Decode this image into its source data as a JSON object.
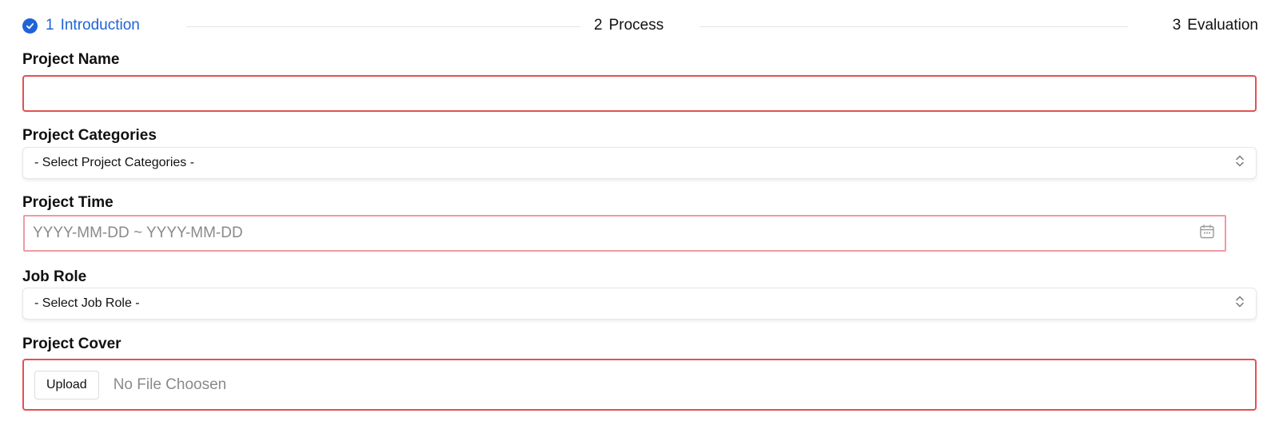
{
  "stepper": {
    "steps": [
      {
        "number": "1",
        "label": "Introduction",
        "state": "active"
      },
      {
        "number": "2",
        "label": "Process",
        "state": "upcoming"
      },
      {
        "number": "3",
        "label": "Evaluation",
        "state": "upcoming"
      }
    ]
  },
  "form": {
    "project_name": {
      "label": "Project Name",
      "value": ""
    },
    "project_categories": {
      "label": "Project Categories",
      "selected": "- Select Project Categories -"
    },
    "project_time": {
      "label": "Project Time",
      "placeholder": "YYYY-MM-DD ~ YYYY-MM-DD"
    },
    "job_role": {
      "label": "Job Role",
      "selected": "- Select Job Role -"
    },
    "project_cover": {
      "label": "Project Cover",
      "button_label": "Upload",
      "status": "No File Choosen"
    }
  },
  "colors": {
    "accent": "#1f63d8",
    "error": "#e05252",
    "placeholder": "#8a8a8a"
  }
}
